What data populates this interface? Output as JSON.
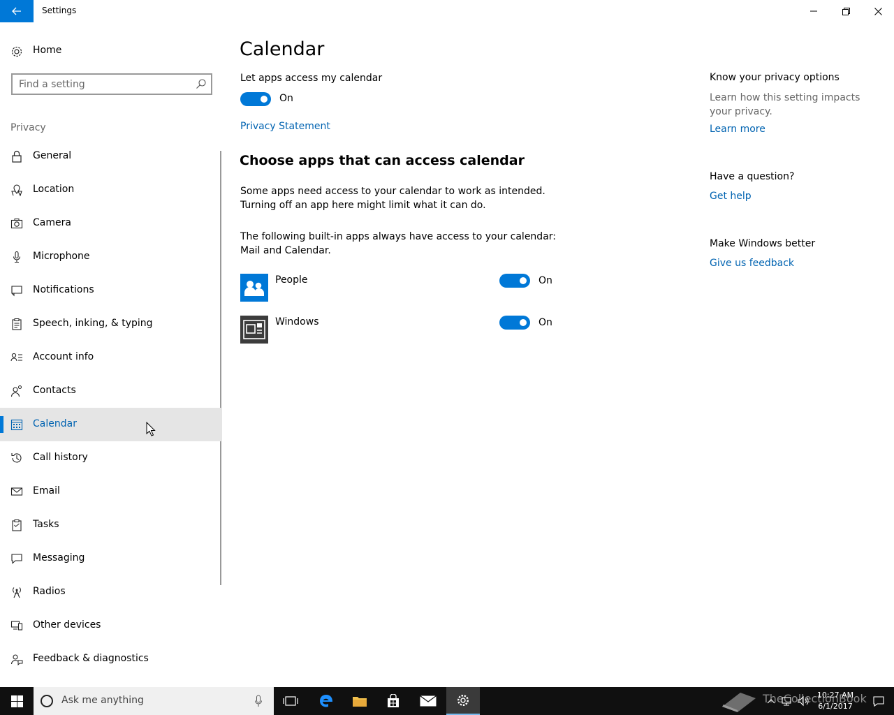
{
  "window": {
    "title": "Settings"
  },
  "sidebar": {
    "home_label": "Home",
    "search_placeholder": "Find a setting",
    "section_label": "Privacy",
    "items": [
      {
        "label": "General",
        "icon": "lock-icon"
      },
      {
        "label": "Location",
        "icon": "location-icon"
      },
      {
        "label": "Camera",
        "icon": "camera-icon"
      },
      {
        "label": "Microphone",
        "icon": "microphone-icon"
      },
      {
        "label": "Notifications",
        "icon": "notifications-icon"
      },
      {
        "label": "Speech, inking, & typing",
        "icon": "clipboard-icon"
      },
      {
        "label": "Account info",
        "icon": "account-info-icon"
      },
      {
        "label": "Contacts",
        "icon": "contacts-icon"
      },
      {
        "label": "Calendar",
        "icon": "calendar-icon",
        "selected": true
      },
      {
        "label": "Call history",
        "icon": "history-icon"
      },
      {
        "label": "Email",
        "icon": "mail-icon"
      },
      {
        "label": "Tasks",
        "icon": "tasks-icon"
      },
      {
        "label": "Messaging",
        "icon": "messaging-icon"
      },
      {
        "label": "Radios",
        "icon": "radio-icon"
      },
      {
        "label": "Other devices",
        "icon": "devices-icon"
      },
      {
        "label": "Feedback & diagnostics",
        "icon": "feedback-icon"
      }
    ]
  },
  "main": {
    "title": "Calendar",
    "access_label": "Let apps access my calendar",
    "access_state": "On",
    "privacy_link": "Privacy Statement",
    "choose_heading": "Choose apps that can access calendar",
    "para1_line1": "Some apps need access to your calendar to work as intended.",
    "para1_line2": "Turning off an app here might limit what it can do.",
    "para2_line1": "The following built-in apps always have access to your calendar:",
    "para2_line2": "Mail and Calendar.",
    "apps": [
      {
        "name": "People",
        "state": "On",
        "icon": "people-app-icon"
      },
      {
        "name": "Windows",
        "state": "On",
        "icon": "windows-app-icon"
      }
    ]
  },
  "right": {
    "privacy_heading": "Know your privacy options",
    "privacy_text": "Learn how this setting impacts your privacy.",
    "learn_more": "Learn more",
    "question_heading": "Have a question?",
    "get_help": "Get help",
    "better_heading": "Make Windows better",
    "feedback_link": "Give us feedback"
  },
  "taskbar": {
    "search_placeholder": "Ask me anything",
    "time": "10:27 AM",
    "date": "6/1/2017",
    "watermark": "TheCollectionBook"
  },
  "colors": {
    "accent": "#0078d7",
    "link": "#0063b1",
    "selected_bg": "#e5e5e5",
    "taskbar": "#101010"
  }
}
